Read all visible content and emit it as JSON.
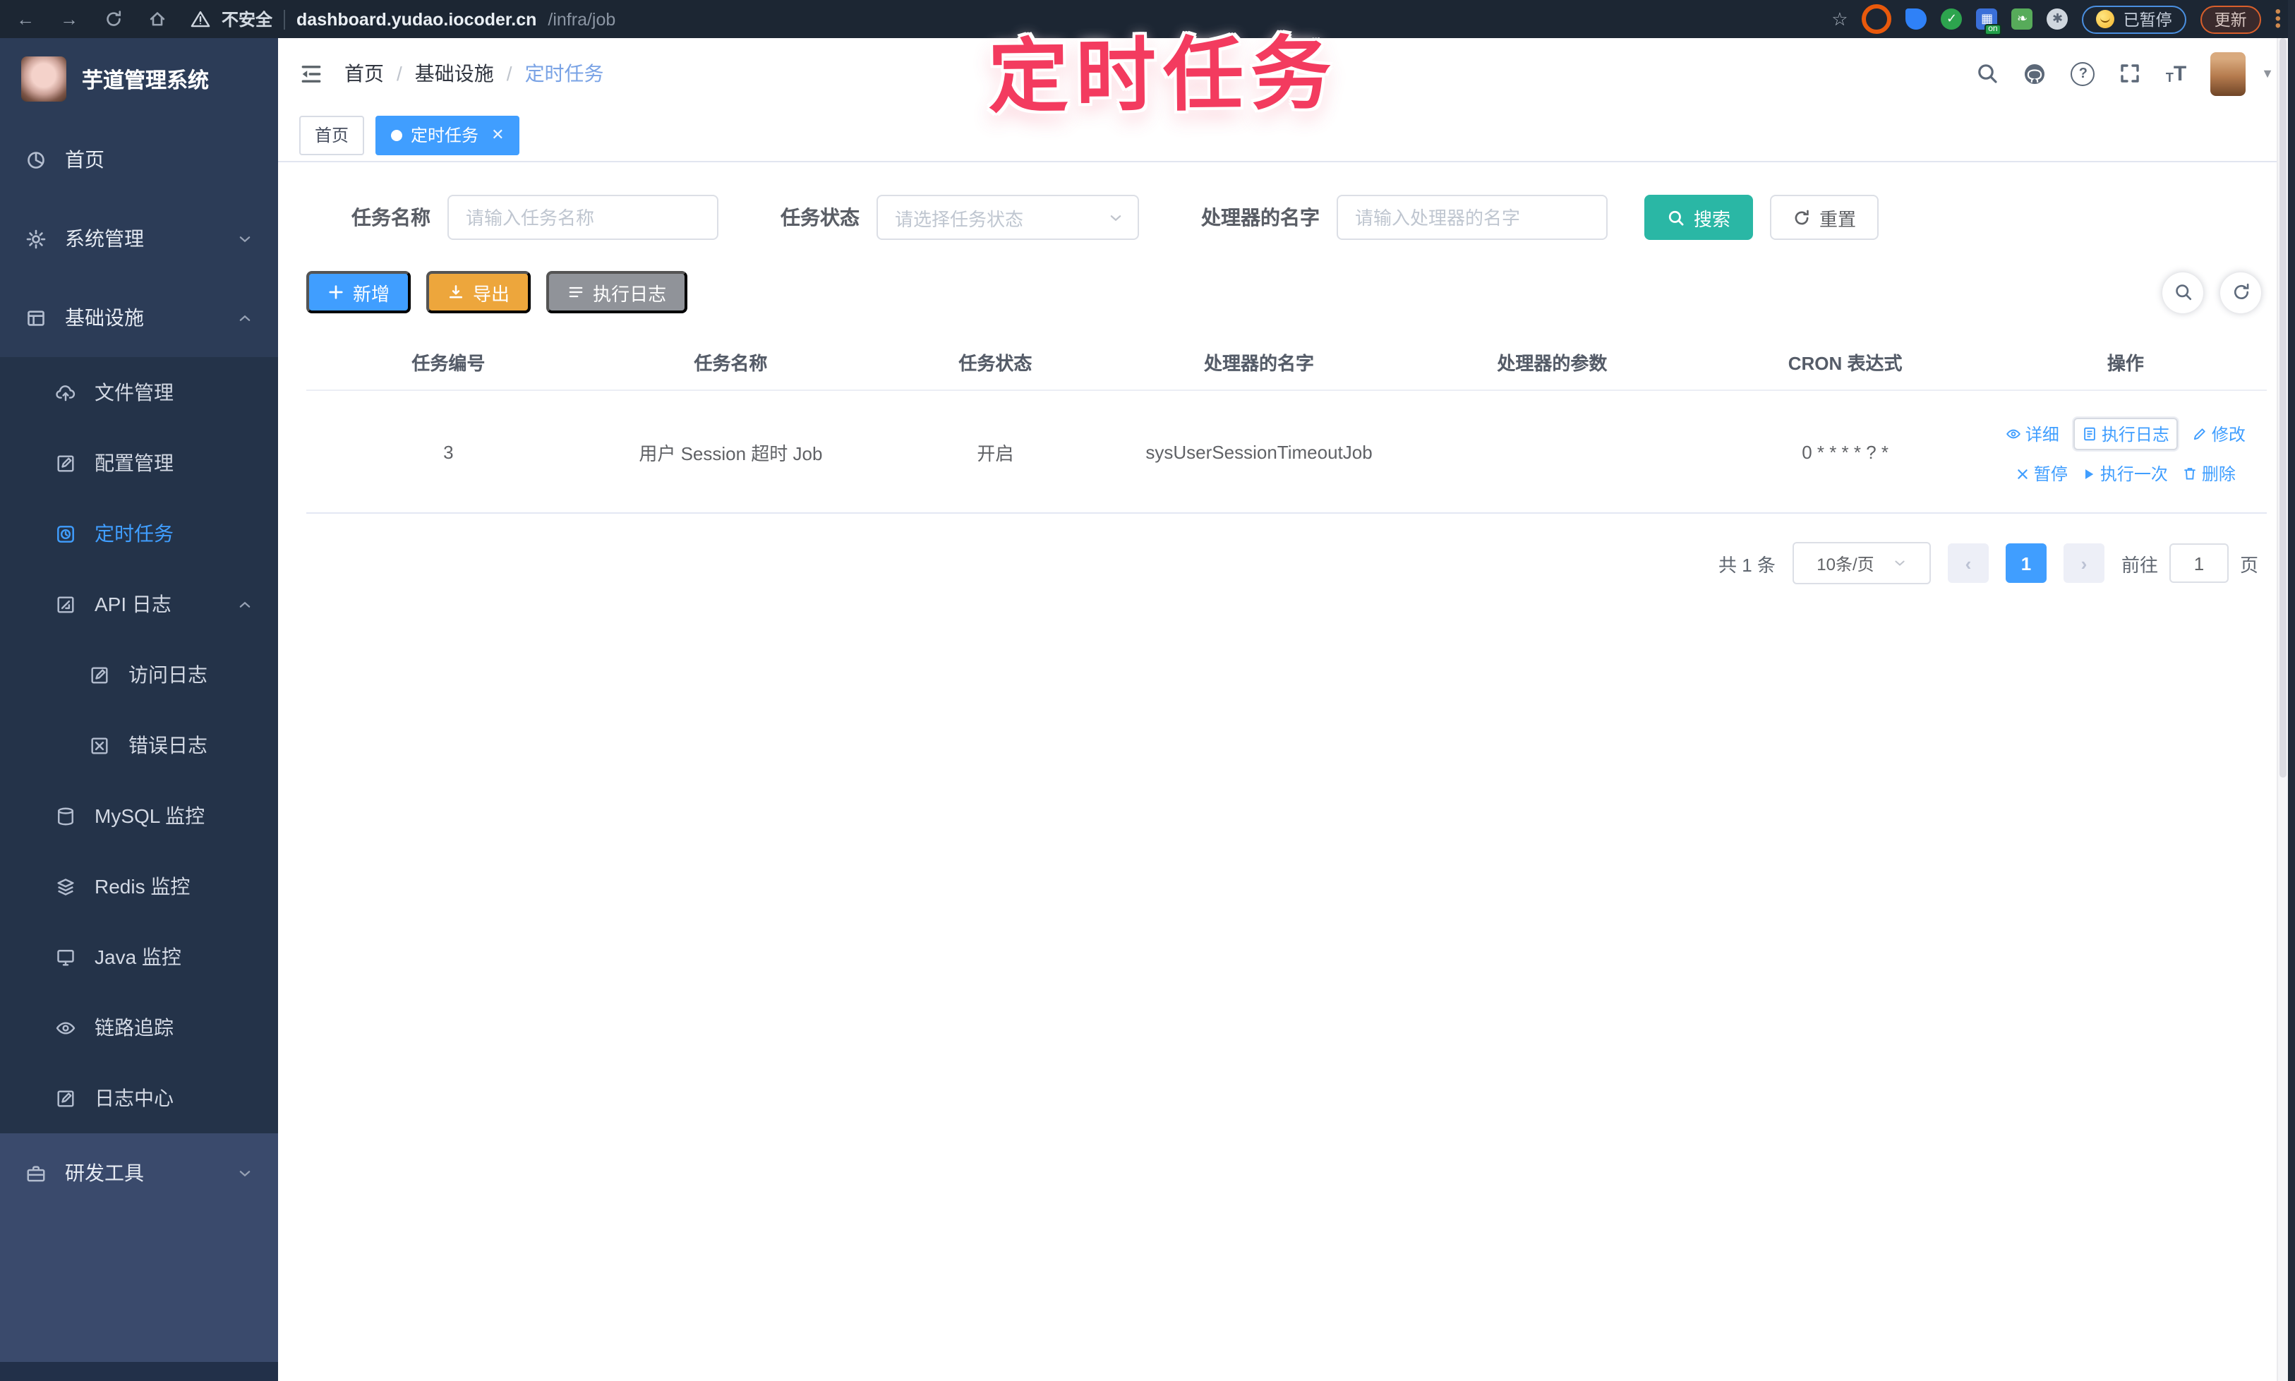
{
  "browser": {
    "security_label": "不安全",
    "url_host": "dashboard.yudao.iocoder.cn",
    "url_path": "/infra/job",
    "paused_badge": "已暂停",
    "update_button": "更新"
  },
  "overlay": {
    "title": "定时任务"
  },
  "sidebar": {
    "app_title": "芋道管理系统",
    "items": [
      {
        "label": "首页"
      },
      {
        "label": "系统管理"
      },
      {
        "label": "基础设施"
      },
      {
        "label": "文件管理"
      },
      {
        "label": "配置管理"
      },
      {
        "label": "定时任务"
      },
      {
        "label": "API 日志"
      },
      {
        "label": "访问日志"
      },
      {
        "label": "错误日志"
      },
      {
        "label": "MySQL 监控"
      },
      {
        "label": "Redis 监控"
      },
      {
        "label": "Java 监控"
      },
      {
        "label": "链路追踪"
      },
      {
        "label": "日志中心"
      },
      {
        "label": "研发工具"
      }
    ]
  },
  "header": {
    "breadcrumb": [
      "首页",
      "基础设施",
      "定时任务"
    ]
  },
  "tabs": [
    {
      "label": "首页"
    },
    {
      "label": "定时任务"
    }
  ],
  "filters": {
    "name_label": "任务名称",
    "name_placeholder": "请输入任务名称",
    "status_label": "任务状态",
    "status_placeholder": "请选择任务状态",
    "handler_label": "处理器的名字",
    "handler_placeholder": "请输入处理器的名字",
    "search_label": "搜索",
    "reset_label": "重置"
  },
  "toolbar": {
    "add_label": "新增",
    "export_label": "导出",
    "exec_log_label": "执行日志"
  },
  "table": {
    "headers": [
      "任务编号",
      "任务名称",
      "任务状态",
      "处理器的名字",
      "处理器的参数",
      "CRON 表达式",
      "操作"
    ],
    "rows": [
      {
        "id": "3",
        "name": "用户 Session 超时 Job",
        "status": "开启",
        "handler": "sysUserSessionTimeoutJob",
        "param": "",
        "cron": "0 * * * * ? *"
      }
    ],
    "actions": {
      "detail": "详细",
      "exec_log": "执行日志",
      "edit": "修改",
      "pause": "暂停",
      "run_once": "执行一次",
      "delete": "删除"
    }
  },
  "pagination": {
    "total": "共 1 条",
    "page_size": "10条/页",
    "current_page": "1",
    "goto_label": "前往",
    "goto_value": "1",
    "page_unit": "页"
  },
  "colors": {
    "accent": "#409eff",
    "search_button": "#2ab7a5",
    "export_button": "#eda63c",
    "info_button": "#909399",
    "overlay_text": "#f33b5f",
    "chrome_bg": "#1c2633",
    "sidebar_bg": "#2c3c57",
    "submenu_bg": "#243349",
    "devtools_bg": "#3a4a6c"
  }
}
